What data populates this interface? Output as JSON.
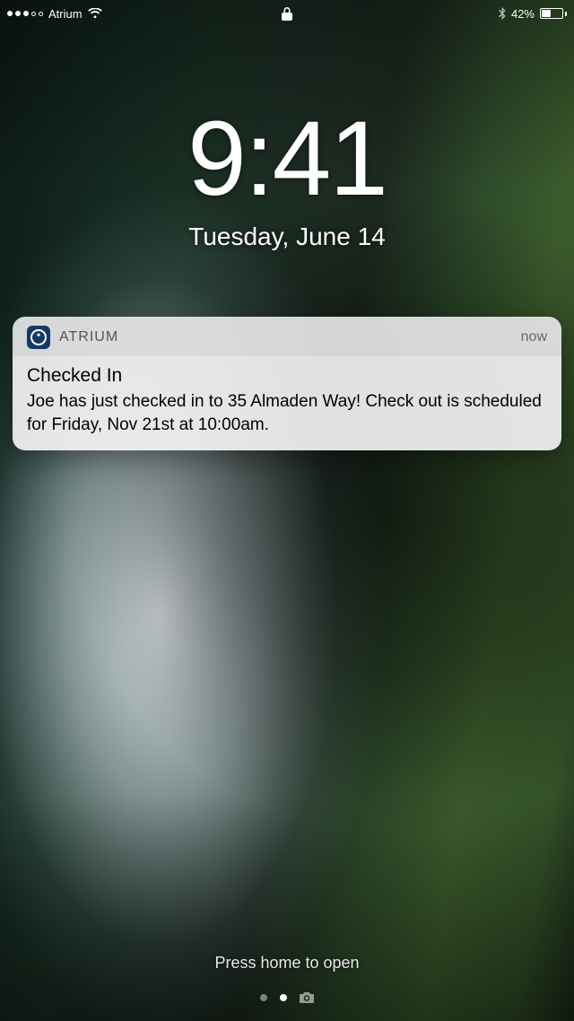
{
  "status_bar": {
    "carrier": "Atrium",
    "battery_percent": "42%"
  },
  "clock": {
    "time": "9:41",
    "date": "Tuesday, June 14"
  },
  "notification": {
    "app_name": "ATRIUM",
    "timestamp": "now",
    "title": "Checked In",
    "message": "Joe has just checked in to 35 Almaden Way! Check out is scheduled for Friday, Nov 21st at 10:00am."
  },
  "bottom": {
    "hint": "Press home to open"
  }
}
